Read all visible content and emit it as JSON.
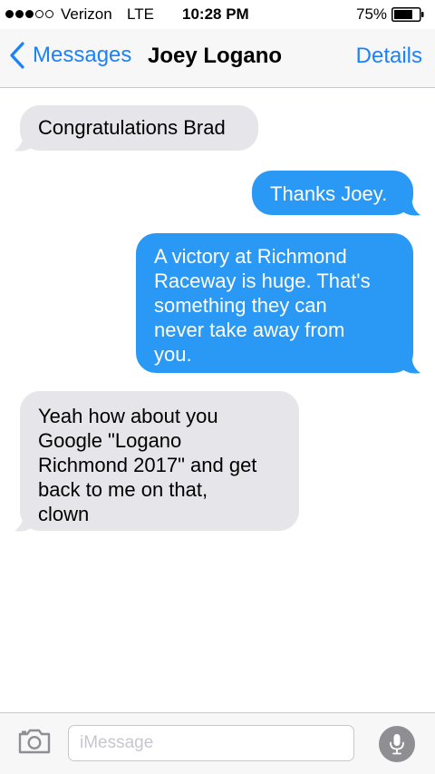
{
  "status_bar": {
    "signal_dots_filled": 3,
    "signal_dots_total": 5,
    "carrier": "Verizon",
    "network": "LTE",
    "time": "10:28 PM",
    "battery_percent": "75%",
    "battery_level": 0.75
  },
  "nav": {
    "back_label": "Messages",
    "title": "Joey Logano",
    "details_label": "Details"
  },
  "messages": [
    {
      "direction": "incoming",
      "lines": [
        "Congratulations Brad"
      ]
    },
    {
      "direction": "outgoing",
      "lines": [
        "Thanks Joey."
      ]
    },
    {
      "direction": "outgoing",
      "lines": [
        "A victory at Richmond",
        "Raceway is huge. That's",
        "something they can",
        "never take away from",
        "you."
      ]
    },
    {
      "direction": "incoming",
      "lines": [
        "Yeah how about you",
        "Google \"Logano",
        "Richmond 2017\" and get",
        "back to me on that,",
        "clown"
      ]
    }
  ],
  "input_bar": {
    "placeholder": "iMessage",
    "value": ""
  },
  "colors": {
    "accent": "#1a82fb",
    "outgoing_bubble": "#2a98f5",
    "incoming_bubble": "#e5e5ea"
  },
  "icons": {
    "back": "chevron-left-icon",
    "camera": "camera-icon",
    "mic": "microphone-icon"
  }
}
